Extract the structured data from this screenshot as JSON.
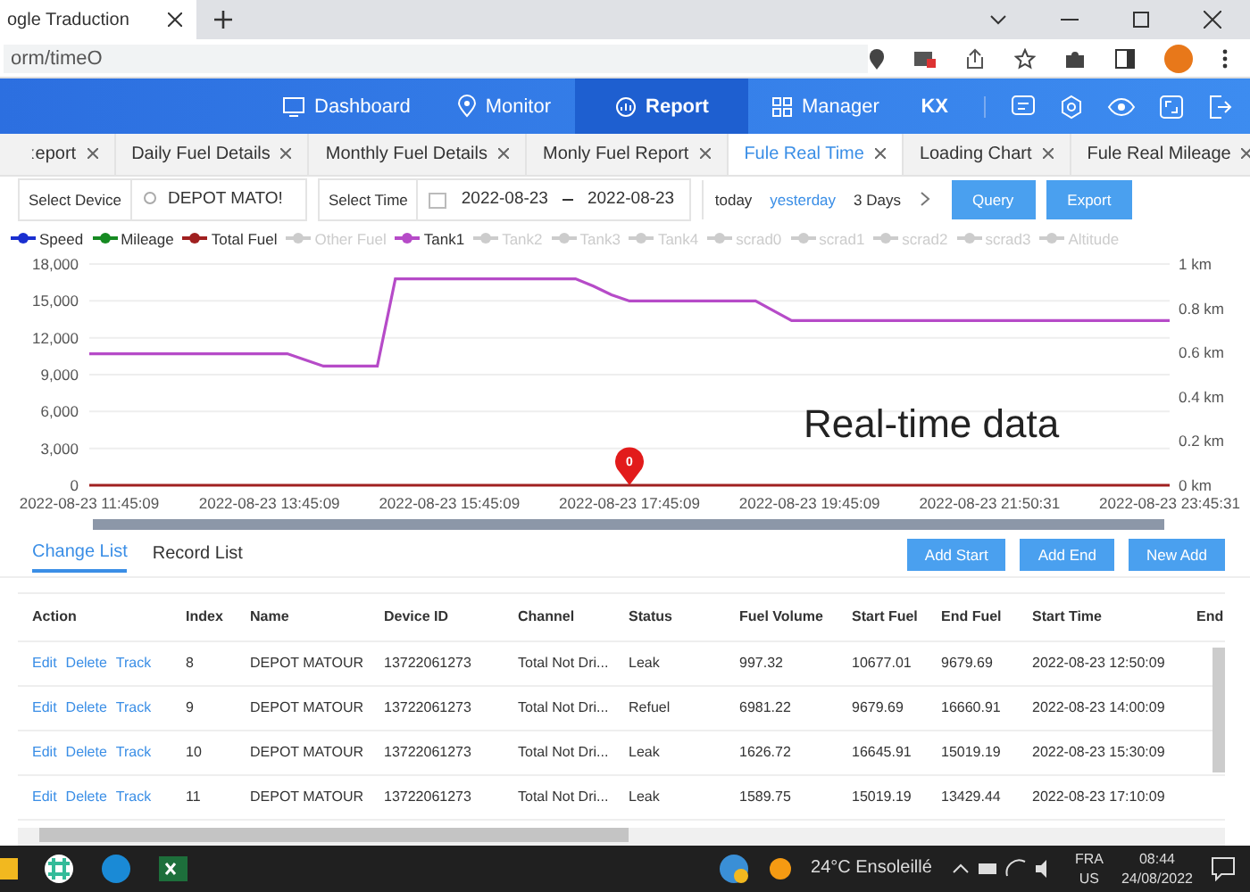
{
  "browser": {
    "tab_title": "ogle Traduction",
    "address": "orm/timeO"
  },
  "nav": {
    "items": [
      {
        "label": "Dashboard",
        "selected": false
      },
      {
        "label": "Monitor",
        "selected": false
      },
      {
        "label": "Report",
        "selected": true
      },
      {
        "label": "Manager",
        "selected": false
      }
    ],
    "user": "KX"
  },
  "tabs": [
    {
      "label": "ːeport",
      "selected": false
    },
    {
      "label": "Daily Fuel Details",
      "selected": false
    },
    {
      "label": "Monthly Fuel Details",
      "selected": false
    },
    {
      "label": "Monly Fuel Report",
      "selected": false
    },
    {
      "label": "Fule Real Time",
      "selected": true
    },
    {
      "label": "Loading Chart",
      "selected": false
    },
    {
      "label": "Fule Real Mileage",
      "selected": false
    }
  ],
  "filters": {
    "device_label": "Select Device",
    "device": "DEPOT MATO!",
    "time_label": "Select Time",
    "from": "2022-08-23",
    "to": "2022-08-23",
    "quick": [
      {
        "label": "today",
        "selected": false
      },
      {
        "label": "yesterday",
        "selected": true
      },
      {
        "label": "3 Days",
        "selected": false
      }
    ],
    "buttons": [
      "Query",
      "Export"
    ]
  },
  "chart": {
    "caption": "Real-time data",
    "marker": "0",
    "right_axis_labels": [
      "1 km",
      "0.8 km",
      "0.6 km",
      "0.4 km",
      "0.2 km",
      "0 km"
    ],
    "legend": [
      {
        "enabled": true
      },
      {
        "enabled": true
      },
      {
        "enabled": true
      },
      {
        "enabled": false
      },
      {
        "enabled": true
      },
      {
        "enabled": false
      },
      {
        "enabled": false
      },
      {
        "enabled": false
      },
      {
        "enabled": false
      },
      {
        "enabled": false
      },
      {
        "enabled": false
      },
      {
        "enabled": false
      },
      {
        "enabled": false
      }
    ],
    "chart_data": {
      "type": "line",
      "grid": true,
      "categories": [
        "2022-08-23 11:45:09",
        null,
        null,
        null,
        null,
        null,
        null,
        null,
        null,
        null,
        "2022-08-23 13:45:09",
        null,
        null,
        null,
        null,
        null,
        null,
        null,
        null,
        null,
        "2022-08-23 15:45:09",
        null,
        null,
        null,
        null,
        null,
        null,
        null,
        null,
        null,
        "2022-08-23 17:45:09",
        null,
        null,
        null,
        null,
        null,
        null,
        null,
        null,
        null,
        "2022-08-23 19:45:09",
        null,
        null,
        null,
        null,
        null,
        null,
        null,
        null,
        null,
        "2022-08-23 21:50:31",
        null,
        null,
        null,
        null,
        null,
        null,
        null,
        null,
        null,
        "2022-08-23 23:45:31"
      ],
      "series": [
        {
          "name": "Speed",
          "color": "#1a2fd0",
          "values": [
            null,
            null,
            null,
            null,
            null,
            null,
            null,
            null,
            null,
            null,
            null,
            null,
            null,
            null,
            null,
            null,
            null,
            null,
            null,
            null,
            null,
            null,
            null,
            null,
            null,
            null,
            null,
            null,
            null,
            null,
            null,
            null,
            null,
            null,
            null,
            null,
            null,
            null,
            null,
            null,
            null,
            null,
            null,
            null,
            null,
            null,
            null,
            null,
            null,
            null,
            null,
            null,
            null,
            null,
            null,
            null,
            null,
            null,
            null,
            null,
            null
          ]
        },
        {
          "name": "Mileage",
          "color": "#168a22",
          "values": [
            null,
            null,
            null,
            null,
            null,
            null,
            null,
            null,
            null,
            null,
            null,
            null,
            null,
            null,
            null,
            null,
            null,
            null,
            null,
            null,
            null,
            null,
            null,
            null,
            null,
            null,
            null,
            null,
            null,
            null,
            null,
            null,
            null,
            null,
            null,
            null,
            null,
            null,
            null,
            null,
            null,
            null,
            null,
            null,
            null,
            null,
            null,
            null,
            null,
            null,
            null,
            null,
            null,
            null,
            null,
            null,
            null,
            null,
            null,
            null,
            null
          ]
        },
        {
          "name": "Total Fuel",
          "color": "#a02020",
          "values": [
            0,
            0,
            0,
            0,
            0,
            0,
            0,
            0,
            0,
            0,
            0,
            0,
            0,
            0,
            0,
            0,
            0,
            0,
            0,
            0,
            0,
            0,
            0,
            0,
            0,
            0,
            0,
            0,
            0,
            0,
            0,
            0,
            0,
            0,
            0,
            0,
            0,
            0,
            0,
            0,
            0,
            0,
            0,
            0,
            0,
            0,
            0,
            0,
            0,
            0,
            0,
            0,
            0,
            0,
            0,
            0,
            0,
            0,
            0,
            0,
            0
          ]
        },
        {
          "name": "Other Fuel",
          "color": "#cccccc",
          "values": [
            null,
            null,
            null,
            null,
            null,
            null,
            null,
            null,
            null,
            null,
            null,
            null,
            null,
            null,
            null,
            null,
            null,
            null,
            null,
            null,
            null,
            null,
            null,
            null,
            null,
            null,
            null,
            null,
            null,
            null,
            null,
            null,
            null,
            null,
            null,
            null,
            null,
            null,
            null,
            null,
            null,
            null,
            null,
            null,
            null,
            null,
            null,
            null,
            null,
            null,
            null,
            null,
            null,
            null,
            null,
            null,
            null,
            null,
            null,
            null,
            null
          ]
        },
        {
          "name": "Tank1",
          "color": "#b64bc8",
          "values": [
            10700,
            10700,
            10700,
            10700,
            10700,
            10700,
            10700,
            10700,
            10700,
            10700,
            10700,
            10700,
            10200,
            9700,
            9700,
            9700,
            9700,
            16800,
            16800,
            16800,
            16800,
            16800,
            16800,
            16800,
            16800,
            16800,
            16800,
            16800,
            16200,
            15500,
            15000,
            15000,
            15000,
            15000,
            15000,
            15000,
            15000,
            15000,
            14200,
            13400,
            13400,
            13400,
            13400,
            13400,
            13400,
            13400,
            13400,
            13400,
            13400,
            13400,
            13400,
            13400,
            13400,
            13400,
            13400,
            13400,
            13400,
            13400,
            13400,
            13400,
            13400
          ]
        },
        {
          "name": "Tank2",
          "color": "#cccccc",
          "values": [
            null,
            null,
            null,
            null,
            null,
            null,
            null,
            null,
            null,
            null,
            null,
            null,
            null,
            null,
            null,
            null,
            null,
            null,
            null,
            null,
            null,
            null,
            null,
            null,
            null,
            null,
            null,
            null,
            null,
            null,
            null,
            null,
            null,
            null,
            null,
            null,
            null,
            null,
            null,
            null,
            null,
            null,
            null,
            null,
            null,
            null,
            null,
            null,
            null,
            null,
            null,
            null,
            null,
            null,
            null,
            null,
            null,
            null,
            null,
            null,
            null
          ]
        },
        {
          "name": "Tank3",
          "color": "#cccccc",
          "values": [
            null,
            null,
            null,
            null,
            null,
            null,
            null,
            null,
            null,
            null,
            null,
            null,
            null,
            null,
            null,
            null,
            null,
            null,
            null,
            null,
            null,
            null,
            null,
            null,
            null,
            null,
            null,
            null,
            null,
            null,
            null,
            null,
            null,
            null,
            null,
            null,
            null,
            null,
            null,
            null,
            null,
            null,
            null,
            null,
            null,
            null,
            null,
            null,
            null,
            null,
            null,
            null,
            null,
            null,
            null,
            null,
            null,
            null,
            null,
            null,
            null
          ]
        },
        {
          "name": "Tank4",
          "color": "#cccccc",
          "values": [
            null,
            null,
            null,
            null,
            null,
            null,
            null,
            null,
            null,
            null,
            null,
            null,
            null,
            null,
            null,
            null,
            null,
            null,
            null,
            null,
            null,
            null,
            null,
            null,
            null,
            null,
            null,
            null,
            null,
            null,
            null,
            null,
            null,
            null,
            null,
            null,
            null,
            null,
            null,
            null,
            null,
            null,
            null,
            null,
            null,
            null,
            null,
            null,
            null,
            null,
            null,
            null,
            null,
            null,
            null,
            null,
            null,
            null,
            null,
            null,
            null
          ]
        },
        {
          "name": "scrad0",
          "color": "#cccccc",
          "values": [
            null,
            null,
            null,
            null,
            null,
            null,
            null,
            null,
            null,
            null,
            null,
            null,
            null,
            null,
            null,
            null,
            null,
            null,
            null,
            null,
            null,
            null,
            null,
            null,
            null,
            null,
            null,
            null,
            null,
            null,
            null,
            null,
            null,
            null,
            null,
            null,
            null,
            null,
            null,
            null,
            null,
            null,
            null,
            null,
            null,
            null,
            null,
            null,
            null,
            null,
            null,
            null,
            null,
            null,
            null,
            null,
            null,
            null,
            null,
            null,
            null
          ]
        },
        {
          "name": "scrad1",
          "color": "#cccccc",
          "values": [
            null,
            null,
            null,
            null,
            null,
            null,
            null,
            null,
            null,
            null,
            null,
            null,
            null,
            null,
            null,
            null,
            null,
            null,
            null,
            null,
            null,
            null,
            null,
            null,
            null,
            null,
            null,
            null,
            null,
            null,
            null,
            null,
            null,
            null,
            null,
            null,
            null,
            null,
            null,
            null,
            null,
            null,
            null,
            null,
            null,
            null,
            null,
            null,
            null,
            null,
            null,
            null,
            null,
            null,
            null,
            null,
            null,
            null,
            null,
            null,
            null
          ]
        },
        {
          "name": "scrad2",
          "color": "#cccccc",
          "values": [
            null,
            null,
            null,
            null,
            null,
            null,
            null,
            null,
            null,
            null,
            null,
            null,
            null,
            null,
            null,
            null,
            null,
            null,
            null,
            null,
            null,
            null,
            null,
            null,
            null,
            null,
            null,
            null,
            null,
            null,
            null,
            null,
            null,
            null,
            null,
            null,
            null,
            null,
            null,
            null,
            null,
            null,
            null,
            null,
            null,
            null,
            null,
            null,
            null,
            null,
            null,
            null,
            null,
            null,
            null,
            null,
            null,
            null,
            null,
            null,
            null
          ]
        },
        {
          "name": "scrad3",
          "color": "#cccccc",
          "values": [
            null,
            null,
            null,
            null,
            null,
            null,
            null,
            null,
            null,
            null,
            null,
            null,
            null,
            null,
            null,
            null,
            null,
            null,
            null,
            null,
            null,
            null,
            null,
            null,
            null,
            null,
            null,
            null,
            null,
            null,
            null,
            null,
            null,
            null,
            null,
            null,
            null,
            null,
            null,
            null,
            null,
            null,
            null,
            null,
            null,
            null,
            null,
            null,
            null,
            null,
            null,
            null,
            null,
            null,
            null,
            null,
            null,
            null,
            null,
            null,
            null
          ]
        },
        {
          "name": "Altitude",
          "color": "#cccccc",
          "values": [
            null,
            null,
            null,
            null,
            null,
            null,
            null,
            null,
            null,
            null,
            null,
            null,
            null,
            null,
            null,
            null,
            null,
            null,
            null,
            null,
            null,
            null,
            null,
            null,
            null,
            null,
            null,
            null,
            null,
            null,
            null,
            null,
            null,
            null,
            null,
            null,
            null,
            null,
            null,
            null,
            null,
            null,
            null,
            null,
            null,
            null,
            null,
            null,
            null,
            null,
            null,
            null,
            null,
            null,
            null,
            null,
            null,
            null,
            null,
            null,
            null
          ]
        }
      ],
      "ylim": [
        0,
        18000
      ],
      "yticks": [
        {
          "value": 0,
          "label": "0"
        },
        {
          "value": 3000,
          "label": "3,000"
        },
        {
          "value": 6000,
          "label": "6,000"
        },
        {
          "value": 9000,
          "label": "9,000"
        },
        {
          "value": 12000,
          "label": "12,000"
        },
        {
          "value": 15000,
          "label": "15,000"
        },
        {
          "value": 18000,
          "label": "18,000"
        }
      ]
    }
  },
  "list_tabs": [
    {
      "label": "Change List",
      "selected": true
    },
    {
      "label": "Record List",
      "selected": false
    }
  ],
  "list_buttons": [
    "Add Start",
    "Add End",
    "New Add"
  ],
  "table": {
    "columns": [
      "Action",
      "Index",
      "Name",
      "Device ID",
      "Channel",
      "Status",
      "Fuel Volume",
      "Start Fuel",
      "End Fuel",
      "Start Time",
      "End"
    ],
    "rows": [
      [
        [
          "Edit",
          "Delete",
          "Track"
        ],
        "8",
        "DEPOT MATOUR",
        "13722061273",
        "Total Not Dri...",
        "Leak",
        "997.32",
        "10677.01",
        "9679.69",
        "2022-08-23 12:50:09"
      ],
      [
        [
          "Edit",
          "Delete",
          "Track"
        ],
        "9",
        "DEPOT MATOUR",
        "13722061273",
        "Total Not Dri...",
        "Refuel",
        "6981.22",
        "9679.69",
        "16660.91",
        "2022-08-23 14:00:09"
      ],
      [
        [
          "Edit",
          "Delete",
          "Track"
        ],
        "10",
        "DEPOT MATOUR",
        "13722061273",
        "Total Not Dri...",
        "Leak",
        "1626.72",
        "16645.91",
        "15019.19",
        "2022-08-23 15:30:09"
      ],
      [
        [
          "Edit",
          "Delete",
          "Track"
        ],
        "11",
        "DEPOT MATOUR",
        "13722061273",
        "Total Not Dri...",
        "Leak",
        "1589.75",
        "15019.19",
        "13429.44",
        "2022-08-23 17:10:09"
      ]
    ]
  },
  "taskbar": {
    "weather": "24°C  Ensoleillé",
    "lang": "FRA",
    "region": "US",
    "time": "08:44",
    "date": "24/08/2022"
  }
}
